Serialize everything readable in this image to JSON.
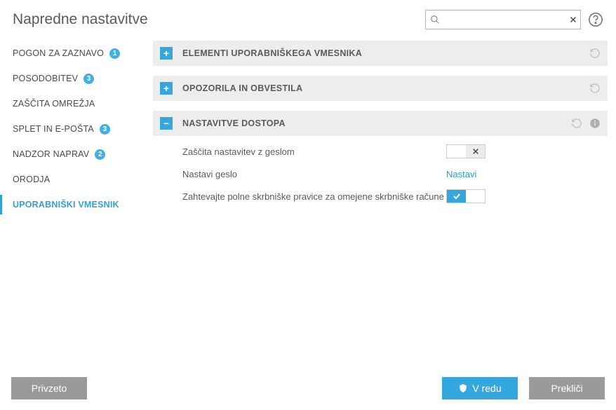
{
  "title": "Napredne nastavitve",
  "search": {
    "placeholder": ""
  },
  "sidebar": {
    "items": [
      {
        "label": "POGON ZA ZAZNAVO",
        "badge": "1"
      },
      {
        "label": "POSODOBITEV",
        "badge": "3"
      },
      {
        "label": "ZAŠČITA OMREŽJA",
        "badge": ""
      },
      {
        "label": "SPLET IN E-POŠTA",
        "badge": "3"
      },
      {
        "label": "NADZOR NAPRAV",
        "badge": "2"
      },
      {
        "label": "ORODJA",
        "badge": ""
      },
      {
        "label": "UPORABNIŠKI VMESNIK",
        "badge": ""
      }
    ]
  },
  "sections": {
    "ui_elements": {
      "title": "ELEMENTI UPORABNIŠKEGA VMESNIKA"
    },
    "alerts": {
      "title": "OPOZORILA IN OBVESTILA"
    },
    "access": {
      "title": "NASTAVITVE DOSTOPA",
      "rows": {
        "password_protect": "Zaščita nastavitev z geslom",
        "set_password": "Nastavi geslo",
        "set_password_action": "Nastavi",
        "require_admin": "Zahtevajte polne skrbniške pravice za omejene skrbniške račune"
      }
    }
  },
  "footer": {
    "default": "Privzeto",
    "ok": "V redu",
    "cancel": "Prekliči"
  }
}
